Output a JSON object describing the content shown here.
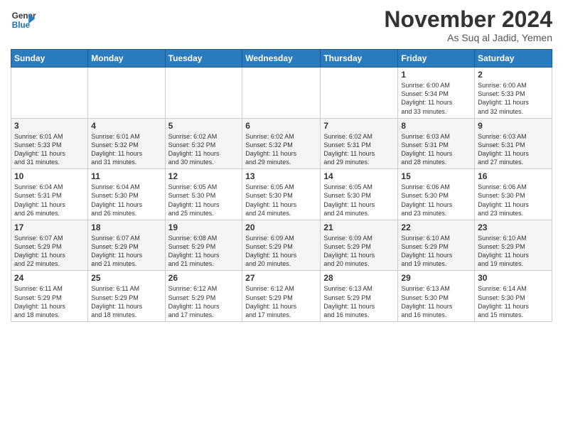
{
  "header": {
    "logo_line1": "General",
    "logo_line2": "Blue",
    "month": "November 2024",
    "location": "As Suq al Jadid, Yemen"
  },
  "weekdays": [
    "Sunday",
    "Monday",
    "Tuesday",
    "Wednesday",
    "Thursday",
    "Friday",
    "Saturday"
  ],
  "weeks": [
    [
      {
        "day": "",
        "info": ""
      },
      {
        "day": "",
        "info": ""
      },
      {
        "day": "",
        "info": ""
      },
      {
        "day": "",
        "info": ""
      },
      {
        "day": "",
        "info": ""
      },
      {
        "day": "1",
        "info": "Sunrise: 6:00 AM\nSunset: 5:34 PM\nDaylight: 11 hours\nand 33 minutes."
      },
      {
        "day": "2",
        "info": "Sunrise: 6:00 AM\nSunset: 5:33 PM\nDaylight: 11 hours\nand 32 minutes."
      }
    ],
    [
      {
        "day": "3",
        "info": "Sunrise: 6:01 AM\nSunset: 5:33 PM\nDaylight: 11 hours\nand 31 minutes."
      },
      {
        "day": "4",
        "info": "Sunrise: 6:01 AM\nSunset: 5:32 PM\nDaylight: 11 hours\nand 31 minutes."
      },
      {
        "day": "5",
        "info": "Sunrise: 6:02 AM\nSunset: 5:32 PM\nDaylight: 11 hours\nand 30 minutes."
      },
      {
        "day": "6",
        "info": "Sunrise: 6:02 AM\nSunset: 5:32 PM\nDaylight: 11 hours\nand 29 minutes."
      },
      {
        "day": "7",
        "info": "Sunrise: 6:02 AM\nSunset: 5:31 PM\nDaylight: 11 hours\nand 29 minutes."
      },
      {
        "day": "8",
        "info": "Sunrise: 6:03 AM\nSunset: 5:31 PM\nDaylight: 11 hours\nand 28 minutes."
      },
      {
        "day": "9",
        "info": "Sunrise: 6:03 AM\nSunset: 5:31 PM\nDaylight: 11 hours\nand 27 minutes."
      }
    ],
    [
      {
        "day": "10",
        "info": "Sunrise: 6:04 AM\nSunset: 5:31 PM\nDaylight: 11 hours\nand 26 minutes."
      },
      {
        "day": "11",
        "info": "Sunrise: 6:04 AM\nSunset: 5:30 PM\nDaylight: 11 hours\nand 26 minutes."
      },
      {
        "day": "12",
        "info": "Sunrise: 6:05 AM\nSunset: 5:30 PM\nDaylight: 11 hours\nand 25 minutes."
      },
      {
        "day": "13",
        "info": "Sunrise: 6:05 AM\nSunset: 5:30 PM\nDaylight: 11 hours\nand 24 minutes."
      },
      {
        "day": "14",
        "info": "Sunrise: 6:05 AM\nSunset: 5:30 PM\nDaylight: 11 hours\nand 24 minutes."
      },
      {
        "day": "15",
        "info": "Sunrise: 6:06 AM\nSunset: 5:30 PM\nDaylight: 11 hours\nand 23 minutes."
      },
      {
        "day": "16",
        "info": "Sunrise: 6:06 AM\nSunset: 5:30 PM\nDaylight: 11 hours\nand 23 minutes."
      }
    ],
    [
      {
        "day": "17",
        "info": "Sunrise: 6:07 AM\nSunset: 5:29 PM\nDaylight: 11 hours\nand 22 minutes."
      },
      {
        "day": "18",
        "info": "Sunrise: 6:07 AM\nSunset: 5:29 PM\nDaylight: 11 hours\nand 21 minutes."
      },
      {
        "day": "19",
        "info": "Sunrise: 6:08 AM\nSunset: 5:29 PM\nDaylight: 11 hours\nand 21 minutes."
      },
      {
        "day": "20",
        "info": "Sunrise: 6:09 AM\nSunset: 5:29 PM\nDaylight: 11 hours\nand 20 minutes."
      },
      {
        "day": "21",
        "info": "Sunrise: 6:09 AM\nSunset: 5:29 PM\nDaylight: 11 hours\nand 20 minutes."
      },
      {
        "day": "22",
        "info": "Sunrise: 6:10 AM\nSunset: 5:29 PM\nDaylight: 11 hours\nand 19 minutes."
      },
      {
        "day": "23",
        "info": "Sunrise: 6:10 AM\nSunset: 5:29 PM\nDaylight: 11 hours\nand 19 minutes."
      }
    ],
    [
      {
        "day": "24",
        "info": "Sunrise: 6:11 AM\nSunset: 5:29 PM\nDaylight: 11 hours\nand 18 minutes."
      },
      {
        "day": "25",
        "info": "Sunrise: 6:11 AM\nSunset: 5:29 PM\nDaylight: 11 hours\nand 18 minutes."
      },
      {
        "day": "26",
        "info": "Sunrise: 6:12 AM\nSunset: 5:29 PM\nDaylight: 11 hours\nand 17 minutes."
      },
      {
        "day": "27",
        "info": "Sunrise: 6:12 AM\nSunset: 5:29 PM\nDaylight: 11 hours\nand 17 minutes."
      },
      {
        "day": "28",
        "info": "Sunrise: 6:13 AM\nSunset: 5:29 PM\nDaylight: 11 hours\nand 16 minutes."
      },
      {
        "day": "29",
        "info": "Sunrise: 6:13 AM\nSunset: 5:30 PM\nDaylight: 11 hours\nand 16 minutes."
      },
      {
        "day": "30",
        "info": "Sunrise: 6:14 AM\nSunset: 5:30 PM\nDaylight: 11 hours\nand 15 minutes."
      }
    ]
  ]
}
